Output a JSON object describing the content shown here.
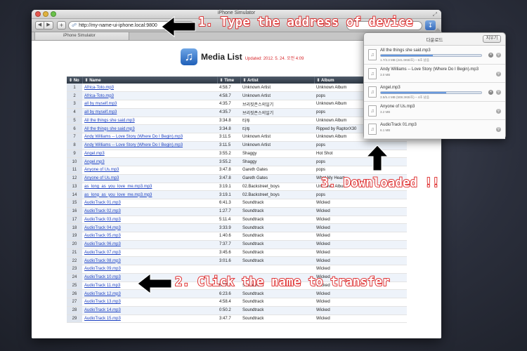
{
  "window": {
    "title": "iPhone Simulator"
  },
  "toolbar": {
    "back_icon": "chevron-left-icon",
    "forward_icon": "chevron-right-icon",
    "add_label": "+",
    "url": "http://my-name-ui-iphone.local:9800",
    "downloads_icon": "download-icon"
  },
  "tab": {
    "label": "iPhone Simulator"
  },
  "page": {
    "title": "Media List",
    "updated": "Updated: 2012. 5. 24. 오전 4:09",
    "icon": "music-note-icon"
  },
  "table": {
    "columns": [
      "⇕ No",
      "⇕ Name",
      "⇕ Time",
      "⇕ Artist",
      "⇕ Album"
    ],
    "rows": [
      {
        "no": "1",
        "name": "Africa-Toto.mp3",
        "time": "4:58.7",
        "artist": "Unknown Artist",
        "album": "Unknown Album"
      },
      {
        "no": "2",
        "name": "Africa-Toto.mp3",
        "time": "4:58.7",
        "artist": "Unknown Artist",
        "album": "pops"
      },
      {
        "no": "3",
        "name": "all by myself.mp3",
        "time": "4:35.7",
        "artist": "브리짓존스의일기",
        "album": "Unknown Album"
      },
      {
        "no": "4",
        "name": "all by myself.mp3",
        "time": "4:35.7",
        "artist": "브리짓존스의일기",
        "album": "pops"
      },
      {
        "no": "5",
        "name": "All the things she said.mp3",
        "time": "3:34.8",
        "artist": "타투",
        "album": "Unknown Album"
      },
      {
        "no": "6",
        "name": "All the things she said.mp3",
        "time": "3:34.8",
        "artist": "타투",
        "album": "Ripped by RaptorX30"
      },
      {
        "no": "7",
        "name": "Andy Williams -- Love Story (Where Do I Begin).mp3",
        "time": "3:11.5",
        "artist": "Unknown Artist",
        "album": "Unknown Album"
      },
      {
        "no": "8",
        "name": "Andy Williams -- Love Story (Where Do I Begin).mp3",
        "time": "3:11.5",
        "artist": "Unknown Artist",
        "album": "pops"
      },
      {
        "no": "9",
        "name": "Angel.mp3",
        "time": "3:55.2",
        "artist": "Shaggy",
        "album": "Hot Shot"
      },
      {
        "no": "10",
        "name": "Angel.mp3",
        "time": "3:55.2",
        "artist": "Shaggy",
        "album": "pops"
      },
      {
        "no": "11",
        "name": "Anyone of Us.mp3",
        "time": "3:47.8",
        "artist": "Gareth Gates",
        "album": "pops"
      },
      {
        "no": "12",
        "name": "Anyone of Us.mp3",
        "time": "3:47.8",
        "artist": "Gareth Gates",
        "album": "What My Heart"
      },
      {
        "no": "13",
        "name": "as_long_as_you_love_me.mp3.mp3",
        "time": "3:19.1",
        "artist": "02.Backstreet_boys",
        "album": "Unknown Album"
      },
      {
        "no": "14",
        "name": "as_long_as_you_love_me.mp3.mp3",
        "time": "3:19.1",
        "artist": "02.Backstreet_boys",
        "album": "pops"
      },
      {
        "no": "15",
        "name": "AudioTrack 01.mp3",
        "time": "6:41.3",
        "artist": "Soundtrack",
        "album": "Wicked"
      },
      {
        "no": "16",
        "name": "AudioTrack 02.mp3",
        "time": "1:27.7",
        "artist": "Soundtrack",
        "album": "Wicked"
      },
      {
        "no": "17",
        "name": "AudioTrack 03.mp3",
        "time": "5:11.4",
        "artist": "Soundtrack",
        "album": "Wicked"
      },
      {
        "no": "18",
        "name": "AudioTrack 04.mp3",
        "time": "3:33.9",
        "artist": "Soundtrack",
        "album": "Wicked"
      },
      {
        "no": "19",
        "name": "AudioTrack 05.mp3",
        "time": "1:40.6",
        "artist": "Soundtrack",
        "album": "Wicked"
      },
      {
        "no": "20",
        "name": "AudioTrack 06.mp3",
        "time": "7:37.7",
        "artist": "Soundtrack",
        "album": "Wicked"
      },
      {
        "no": "21",
        "name": "AudioTrack 07.mp3",
        "time": "3:45.6",
        "artist": "Soundtrack",
        "album": "Wicked"
      },
      {
        "no": "22",
        "name": "AudioTrack 08.mp3",
        "time": "3:01.6",
        "artist": "Soundtrack",
        "album": "Wicked"
      },
      {
        "no": "23",
        "name": "AudioTrack 09.mp3",
        "time": "",
        "artist": "",
        "album": "Wicked"
      },
      {
        "no": "24",
        "name": "AudioTrack 10.mp3",
        "time": "",
        "artist": "",
        "album": "Wicked"
      },
      {
        "no": "25",
        "name": "AudioTrack 11.mp3",
        "time": "5:57.1",
        "artist": "Soundtrack",
        "album": "Wicked"
      },
      {
        "no": "26",
        "name": "AudioTrack 12.mp3",
        "time": "6:23.6",
        "artist": "Soundtrack",
        "album": "Wicked"
      },
      {
        "no": "27",
        "name": "AudioTrack 13.mp3",
        "time": "4:58.4",
        "artist": "Soundtrack",
        "album": "Wicked"
      },
      {
        "no": "28",
        "name": "AudioTrack 14.mp3",
        "time": "0:50.2",
        "artist": "Soundtrack",
        "album": "Wicked"
      },
      {
        "no": "29",
        "name": "AudioTrack 15.mp3",
        "time": "3:47.7",
        "artist": "Soundtrack",
        "album": "Wicked"
      }
    ]
  },
  "downloads": {
    "title": "다운로드",
    "clear_label": "지우기",
    "items": [
      {
        "name": "All the things she said.mp3",
        "status": "1.7/3.3 MB (241.9KB/초) – 6초 남음",
        "progress": 0.52
      },
      {
        "name": "Andy Williams -- Love Story (Where Do I Begin).mp3",
        "status": "3.0 MB",
        "progress": null
      },
      {
        "name": "Angel.mp3",
        "status": "3.5/5.4 MB (508.3KB/초) – 4초 남음",
        "progress": 0.65
      },
      {
        "name": "Anyone of Us.mp3",
        "status": "3.2 MB",
        "progress": null
      },
      {
        "name": "AudioTrack 01.mp3",
        "status": "6.1 MB",
        "progress": null
      }
    ]
  },
  "annotations": {
    "step1": "1. Type the address of device",
    "step2": "2. Click the name to transfer",
    "step3": "3. Downloaded !!"
  },
  "colors": {
    "annotation_stroke": "#d22222",
    "arrow_fill": "#000000",
    "link": "#1a3fc1",
    "updated_text": "#d8282d"
  }
}
